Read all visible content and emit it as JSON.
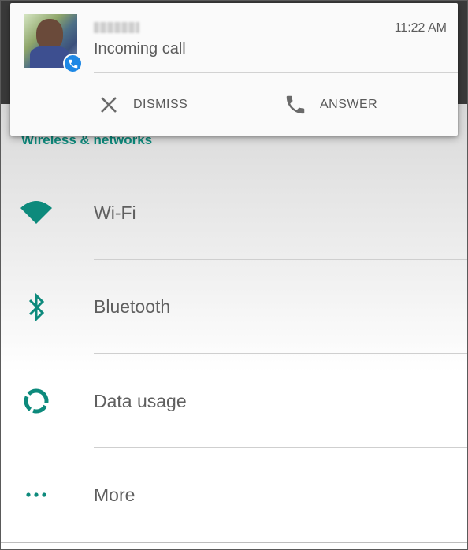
{
  "notification": {
    "caller_name": "",
    "title": "Incoming call",
    "time": "11:22 AM",
    "actions": {
      "dismiss": "DISMISS",
      "answer": "ANSWER"
    }
  },
  "settings": {
    "section_title": "Wireless & networks",
    "items": [
      {
        "label": "Wi-Fi",
        "icon": "wifi-icon"
      },
      {
        "label": "Bluetooth",
        "icon": "bluetooth-icon"
      },
      {
        "label": "Data usage",
        "icon": "data-usage-icon"
      },
      {
        "label": "More",
        "icon": "more-icon"
      }
    ]
  },
  "colors": {
    "accent": "#0d8a7c",
    "badge": "#1e88e5",
    "text": "#5f5f5f"
  }
}
